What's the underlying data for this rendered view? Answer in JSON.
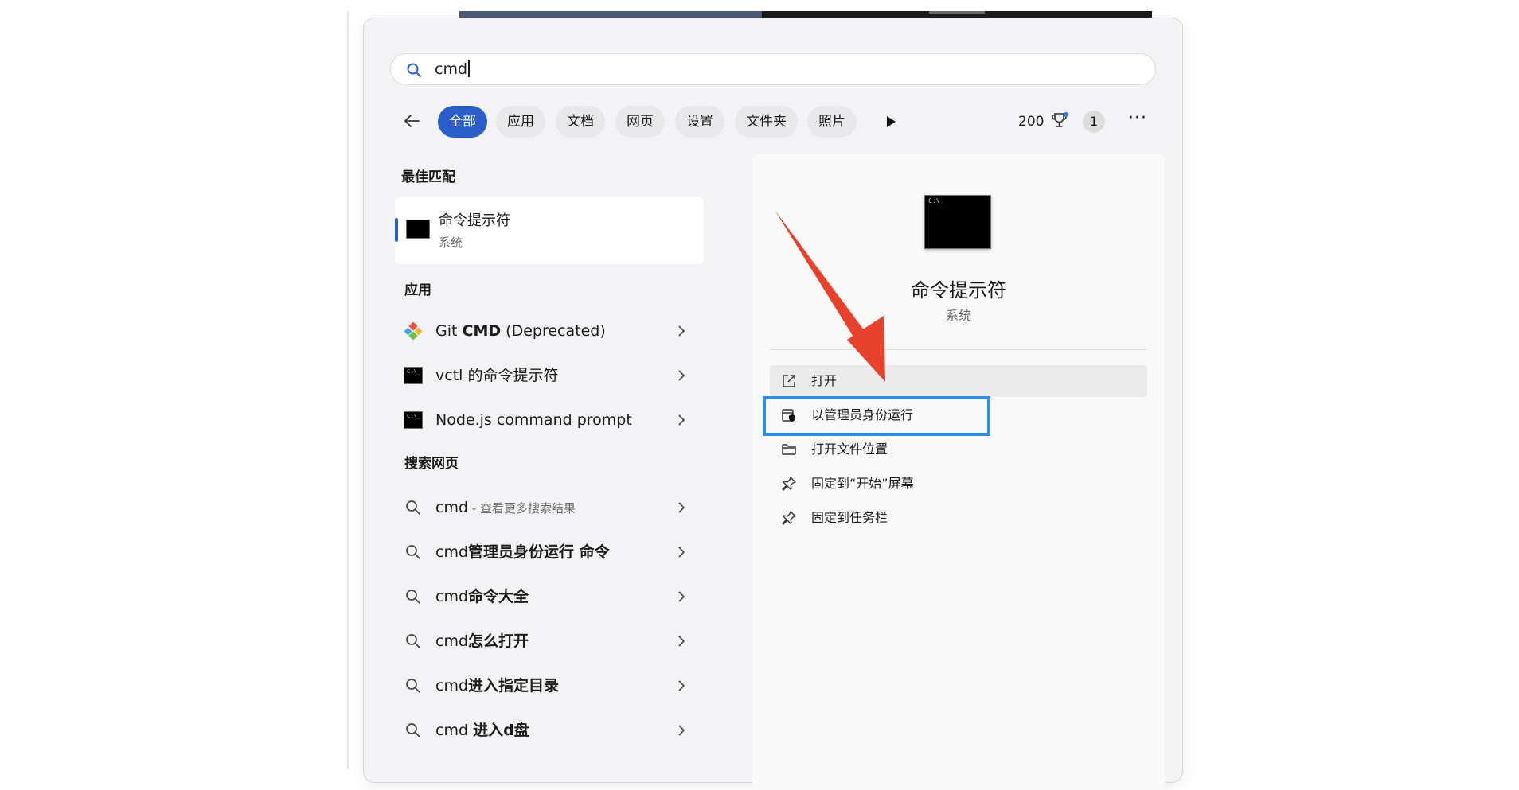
{
  "search": {
    "query": "cmd"
  },
  "filters": {
    "tabs": [
      "全部",
      "应用",
      "文档",
      "网页",
      "设置",
      "文件夹",
      "照片"
    ],
    "points": "200",
    "badge": "1",
    "more": "···"
  },
  "best_match": {
    "heading": "最佳匹配",
    "title": "命令提示符",
    "subtitle": "系统"
  },
  "apps": {
    "heading": "应用",
    "items": [
      {
        "pre": "Git ",
        "bold": "CMD",
        "post": " (Deprecated)",
        "icon": "git-icon"
      },
      {
        "pre": "vctl 的命令提示符",
        "bold": "",
        "post": "",
        "icon": "terminal-icon"
      },
      {
        "pre": "Node.js command prompt",
        "bold": "",
        "post": "",
        "icon": "terminal-icon"
      }
    ]
  },
  "web": {
    "heading": "搜索网页",
    "items": [
      {
        "pre": "cmd",
        "bold": "",
        "hint": " - 查看更多搜索结果"
      },
      {
        "pre": "cmd",
        "bold": "管理员身份运行 命令",
        "hint": ""
      },
      {
        "pre": "cmd",
        "bold": "命令大全",
        "hint": ""
      },
      {
        "pre": "cmd",
        "bold": "怎么打开",
        "hint": ""
      },
      {
        "pre": "cmd",
        "bold": "进入指定目录",
        "hint": ""
      },
      {
        "pre": "cmd ",
        "bold": "进入d盘",
        "hint": ""
      }
    ]
  },
  "preview": {
    "title": "命令提示符",
    "subtitle": "系统",
    "actions": [
      "打开",
      "以管理员身份运行",
      "打开文件位置",
      "固定到“开始”屏幕",
      "固定到任务栏"
    ]
  },
  "colors": {
    "accent": "#2a5fc9",
    "highlight": "#2f8fe8",
    "arrow": "#e8412c"
  }
}
